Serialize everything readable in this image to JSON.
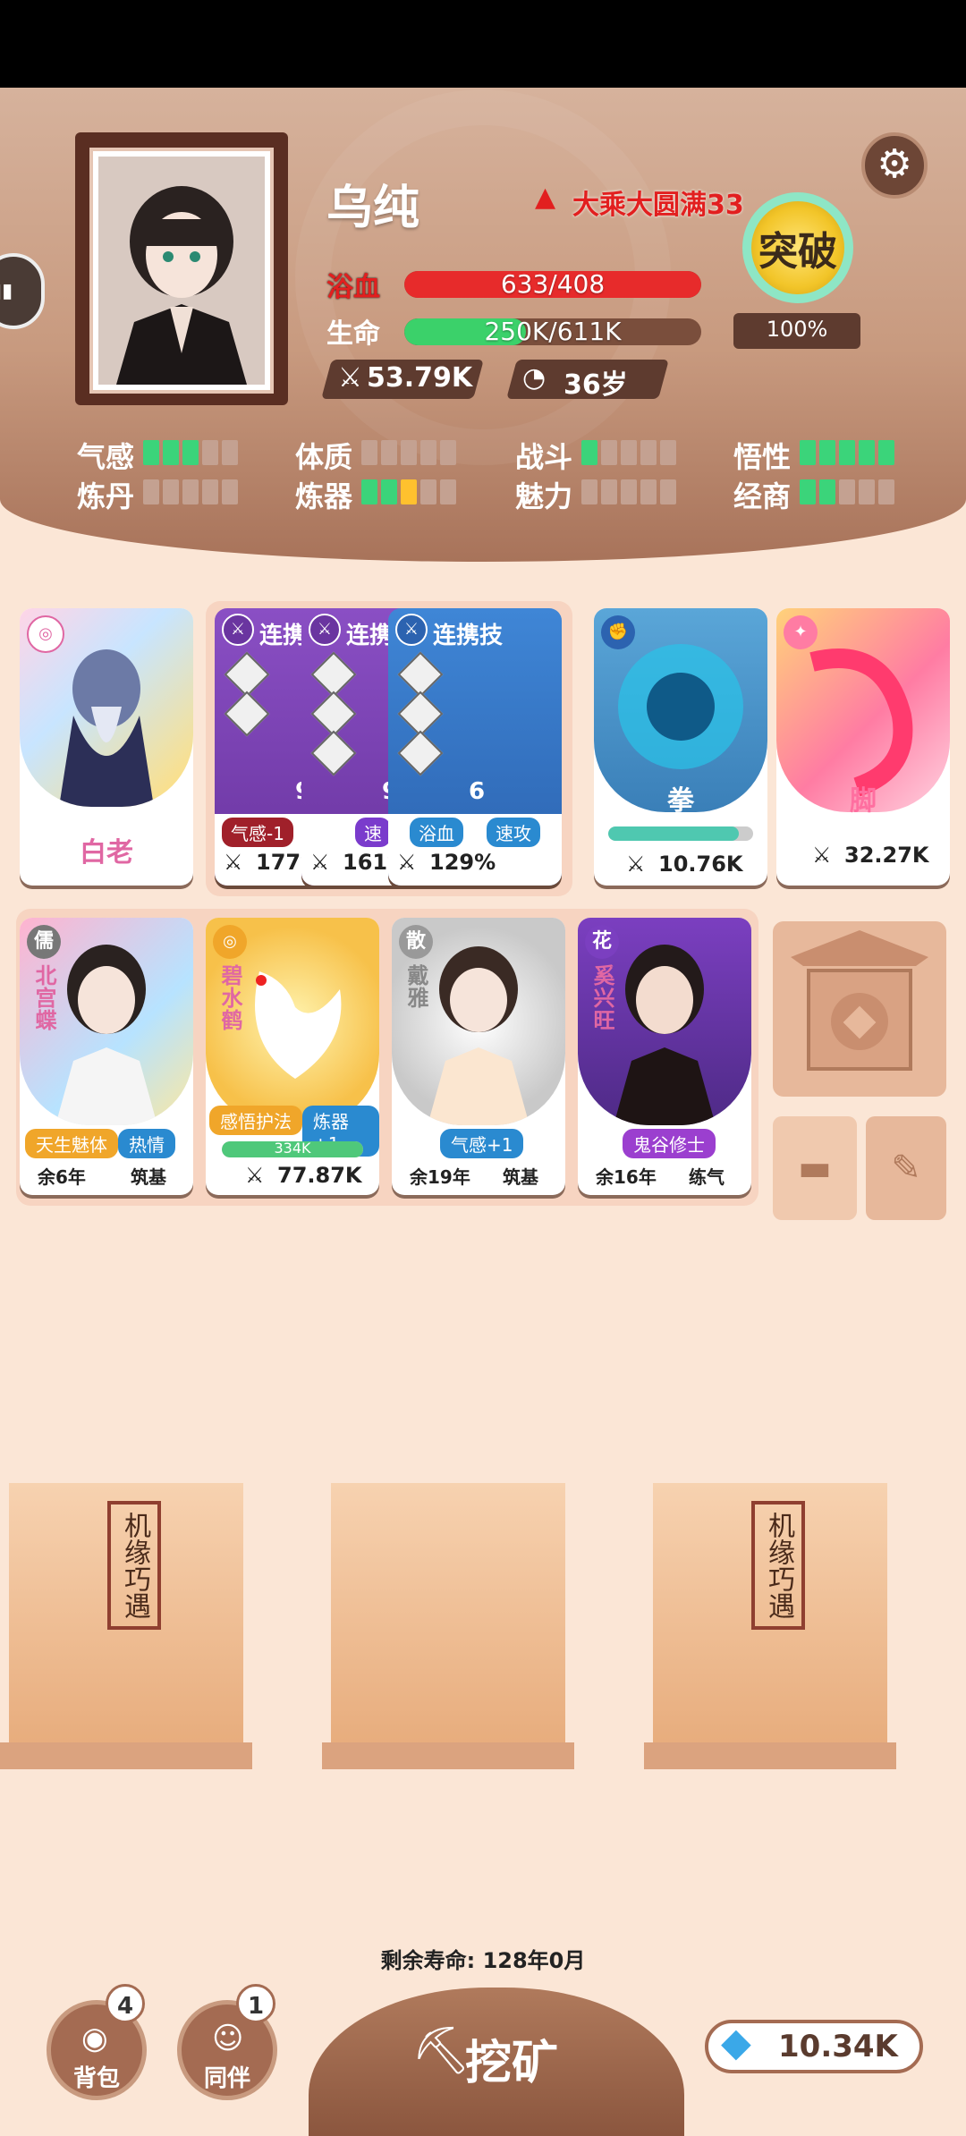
{
  "player": {
    "name": "乌纯",
    "realm": "大乘大圆满33",
    "blood_label": "浴血",
    "blood_value": "633/408",
    "blood_fill": 1.0,
    "life_label": "生命",
    "life_value": "250K/611K",
    "life_fill": 0.41,
    "power": "53.79K",
    "age": "36岁",
    "breakthrough_label": "突破",
    "breakthrough_pct": "100%"
  },
  "attributes": [
    {
      "label": "气感",
      "green": 3,
      "orange": 0
    },
    {
      "label": "体质",
      "green": 0,
      "orange": 0
    },
    {
      "label": "战斗",
      "green": 1,
      "orange": 0
    },
    {
      "label": "悟性",
      "green": 5,
      "orange": 0
    },
    {
      "label": "炼丹",
      "green": 0,
      "orange": 0
    },
    {
      "label": "炼器",
      "green": 2,
      "orange": 1
    },
    {
      "label": "魅力",
      "green": 0,
      "orange": 0
    },
    {
      "label": "经商",
      "green": 2,
      "orange": 0
    }
  ],
  "cards_row1": {
    "baila": {
      "title": "白老"
    },
    "combo": [
      {
        "label": "连携",
        "num": "9",
        "tag": "气感-1",
        "pct": "177%"
      },
      {
        "label": "连携",
        "num": "9",
        "tag": "速",
        "pct": "161%"
      },
      {
        "label": "连携技",
        "num": "6",
        "tag1": "浴血",
        "tag2": "速攻",
        "pct": "129%"
      }
    ],
    "fist": {
      "title": "拳",
      "power": "10.76K",
      "fill": 0.9
    },
    "foot": {
      "title": "脚",
      "power": "32.27K"
    }
  },
  "characters": [
    {
      "badge": "儒",
      "name": "北宫蝶",
      "tag1": "天生魅体",
      "tag2": "热情",
      "remain": "余6年",
      "stage": "筑基"
    },
    {
      "badge": "",
      "name": "碧水鹤",
      "tag1": "感悟护法",
      "tag2": "炼器+1",
      "hp": "334K",
      "power": "77.87K"
    },
    {
      "badge": "散",
      "name": "戴雅",
      "tag1": "气感+1",
      "remain": "余19年",
      "stage": "筑基"
    },
    {
      "badge": "花",
      "name": "奚兴旺",
      "tag1": "鬼谷修士",
      "remain": "余16年",
      "stage": "练气"
    }
  ],
  "gifts": [
    {
      "label": "机缘巧遇"
    },
    {
      "label": ""
    },
    {
      "label": "机缘巧遇"
    }
  ],
  "bottom": {
    "lifespan": "剩余寿命: 128年0月",
    "bag_label": "背包",
    "bag_count": "4",
    "partner_label": "同伴",
    "partner_count": "1",
    "mine_label": "挖矿",
    "currency": "10.34K"
  }
}
